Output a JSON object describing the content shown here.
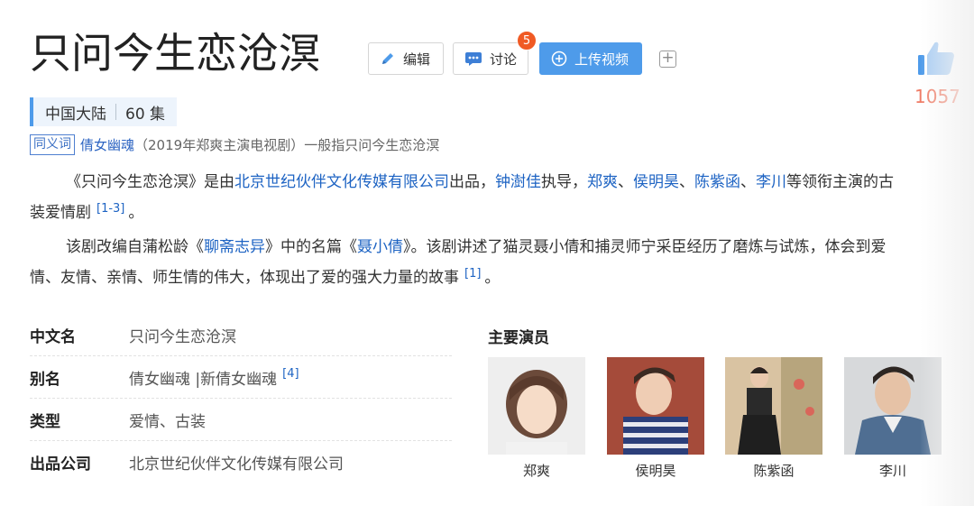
{
  "header": {
    "title": "只问今生恋沧溟",
    "edit_label": "编辑",
    "discuss_label": "讨论",
    "discuss_badge": "5",
    "upload_label": "上传视频",
    "plus_label": "+",
    "like_count": "1057"
  },
  "meta": {
    "region": "中国大陆",
    "episodes": "60 集"
  },
  "synonym": {
    "tag": "同义词",
    "link": "倩女幽魂",
    "description": "（2019年郑爽主演电视剧）一般指只问今生恋沧溟"
  },
  "intro": {
    "p1_pre": "《只问今生恋沧溟》是由",
    "p1_company": "北京世纪伙伴文化传媒有限公司",
    "p1_mid1": "出品，",
    "p1_director": "钟澍佳",
    "p1_mid2": "执导，",
    "p1_actor1": "郑爽",
    "p1_sep1": "、",
    "p1_actor2": "侯明昊",
    "p1_sep2": "、",
    "p1_actor3": "陈紫函",
    "p1_sep3": "、",
    "p1_actor4": "李川",
    "p1_tail": "等领衔主演的古",
    "p1_line2": "装爱情剧",
    "p1_ref": "[1-3]",
    "p1_end": "。",
    "p2_pre": "该剧改编自蒲松龄《",
    "p2_book": "聊斋志异",
    "p2_mid": "》中的名篇《",
    "p2_story": "聂小倩",
    "p2_tail": "》。该剧讲述了猫灵聂小倩和捕灵师宁采臣经历了磨炼与试炼，体会到爱",
    "p2_line2": "情、友情、亲情、师生情的伟大，体现出了爱的强大力量的故事",
    "p2_ref": "[1]",
    "p2_end": "。"
  },
  "basic_info": {
    "rows": [
      {
        "label": "中文名",
        "value": "只问今生恋沧溟"
      },
      {
        "label": "别名",
        "value": "倩女幽魂 |新倩女幽魂",
        "ref": "[4]"
      },
      {
        "label": "类型",
        "value": "爱情、古装"
      },
      {
        "label": "出品公司",
        "value": "北京世纪伙伴文化传媒有限公司"
      }
    ]
  },
  "cast": {
    "title": "主要演员",
    "members": [
      {
        "name": "郑爽"
      },
      {
        "name": "侯明昊"
      },
      {
        "name": "陈紫函"
      },
      {
        "name": "李川"
      }
    ]
  },
  "colors": {
    "accent": "#4e9bea",
    "link": "#1d63c3",
    "badge": "#f05a24",
    "like": "#ef7b65"
  },
  "icons": [
    "pencil-icon",
    "chat-icon",
    "plus-circle-icon",
    "plus-square-icon",
    "thumbs-up-icon"
  ]
}
